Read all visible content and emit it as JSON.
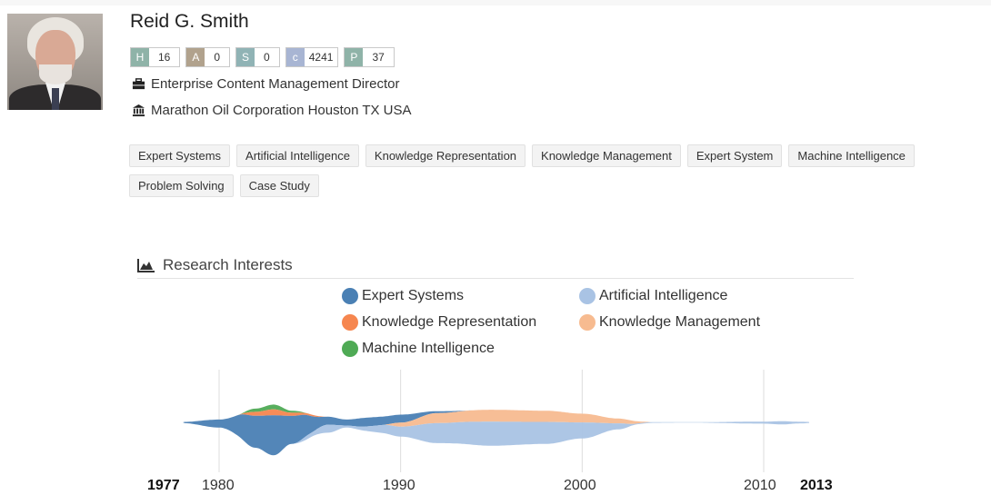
{
  "profile": {
    "name": "Reid G. Smith",
    "position": "Enterprise Content Management Director",
    "organization": "Marathon Oil Corporation Houston TX USA",
    "metrics": [
      {
        "key": "H",
        "value": "16"
      },
      {
        "key": "A",
        "value": "0"
      },
      {
        "key": "S",
        "value": "0"
      },
      {
        "key": "c",
        "value": "4241"
      },
      {
        "key": "P",
        "value": "37"
      }
    ]
  },
  "tags": [
    "Expert Systems",
    "Artificial Intelligence",
    "Knowledge Representation",
    "Knowledge Management",
    "Expert System",
    "Machine Intelligence",
    "Problem Solving",
    "Case Study"
  ],
  "research_interests": {
    "title": "Research Interests",
    "legend": [
      {
        "name": "Expert Systems",
        "color": "#4a80b4"
      },
      {
        "name": "Artificial Intelligence",
        "color": "#a9c3e4"
      },
      {
        "name": "Knowledge Representation",
        "color": "#f6864f"
      },
      {
        "name": "Knowledge Management",
        "color": "#f7bb90"
      },
      {
        "name": "Machine Intelligence",
        "color": "#4faa55"
      }
    ],
    "axis": {
      "start": "1977",
      "end": "2013",
      "ticks": [
        "1980",
        "1990",
        "2000",
        "2010"
      ]
    }
  },
  "chart_data": {
    "type": "area",
    "subtype": "streamgraph",
    "title": "Research Interests",
    "x_range": [
      1977,
      2013
    ],
    "x_ticks": [
      1980,
      1990,
      2000,
      2010
    ],
    "grid": true,
    "legend_placement": "top",
    "series": [
      {
        "name": "Expert Systems",
        "points": [
          [
            1978,
            0.3
          ],
          [
            1980,
            2
          ],
          [
            1982,
            8
          ],
          [
            1983,
            10
          ],
          [
            1984,
            7
          ],
          [
            1986,
            2
          ],
          [
            1987,
            1.5
          ],
          [
            1988,
            2.2
          ],
          [
            1990,
            2
          ],
          [
            1992,
            0.5
          ],
          [
            1994,
            0
          ]
        ]
      },
      {
        "name": "Artificial Intelligence",
        "points": [
          [
            1984,
            0
          ],
          [
            1985,
            1
          ],
          [
            1986,
            2
          ],
          [
            1987,
            0.5
          ],
          [
            1990,
            2.5
          ],
          [
            1992,
            5
          ],
          [
            1995,
            6
          ],
          [
            1998,
            5.5
          ],
          [
            2000,
            4
          ],
          [
            2002,
            1.5
          ],
          [
            2003,
            0.2
          ],
          [
            2006,
            0.1
          ],
          [
            2010,
            0.5
          ],
          [
            2011,
            0.8
          ],
          [
            2012,
            0.4
          ],
          [
            2013,
            0.1
          ]
        ]
      },
      {
        "name": "Knowledge Representation",
        "points": [
          [
            1981,
            0
          ],
          [
            1982,
            1
          ],
          [
            1983,
            1.5
          ],
          [
            1984,
            0.8
          ],
          [
            1985,
            0.4
          ],
          [
            1986,
            0
          ]
        ]
      },
      {
        "name": "Knowledge Management",
        "points": [
          [
            1989,
            0
          ],
          [
            1990,
            1
          ],
          [
            1992,
            2.5
          ],
          [
            1995,
            3
          ],
          [
            1998,
            2.8
          ],
          [
            2000,
            2.2
          ],
          [
            2002,
            1.2
          ],
          [
            2004,
            0
          ]
        ]
      },
      {
        "name": "Machine Intelligence",
        "points": [
          [
            1981,
            0
          ],
          [
            1982,
            0.8
          ],
          [
            1983,
            1.2
          ],
          [
            1984,
            0.5
          ],
          [
            1985,
            0
          ]
        ]
      }
    ]
  }
}
